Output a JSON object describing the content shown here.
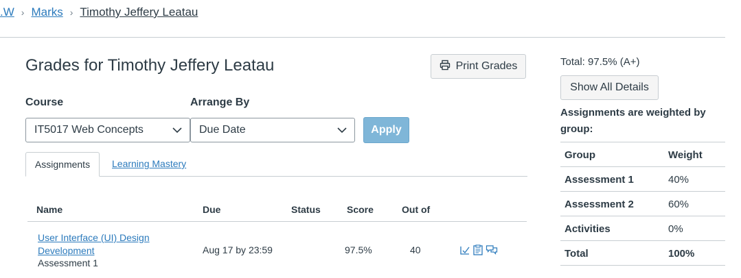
{
  "breadcrumb": {
    "course": ".W",
    "marks": "Marks",
    "student": "Timothy Jeffery Leatau"
  },
  "page": {
    "title": "Grades for Timothy Jeffery Leatau",
    "print_label": "Print Grades"
  },
  "filters": {
    "course_label": "Course",
    "course_value": "IT5017 Web Concepts",
    "arrange_label": "Arrange By",
    "arrange_value": "Due Date",
    "apply_label": "Apply"
  },
  "tabs": [
    {
      "label": "Assignments",
      "active": true
    },
    {
      "label": "Learning Mastery",
      "active": false
    }
  ],
  "table": {
    "headers": [
      "Name",
      "Due",
      "Status",
      "Score",
      "Out of"
    ],
    "rows": [
      {
        "name_line1": "User Interface (UI) Design",
        "name_line2": "Development",
        "group": "Assessment 1",
        "due": "Aug 17 by 23:59",
        "status": "",
        "score": "97.5%",
        "out_of": "40",
        "icons": [
          "rubric-icon",
          "submission-details-icon",
          "comments-icon"
        ]
      }
    ]
  },
  "sidebar": {
    "total": "Total: 97.5% (A+)",
    "show_details_label": "Show All Details",
    "weighted_text": "Assignments are weighted by group:",
    "weights_header": {
      "group": "Group",
      "weight": "Weight"
    },
    "weights": [
      {
        "group": "Assessment 1",
        "weight": "40%"
      },
      {
        "group": "Assessment 2",
        "weight": "60%"
      },
      {
        "group": "Activities",
        "weight": "0%"
      }
    ],
    "weights_total": {
      "group": "Total",
      "weight": "100%"
    }
  },
  "colors": {
    "link": "#2b7abc",
    "apply_button": "#7fb6d8",
    "text": "#2d3b45",
    "border": "#c7cdd1"
  }
}
